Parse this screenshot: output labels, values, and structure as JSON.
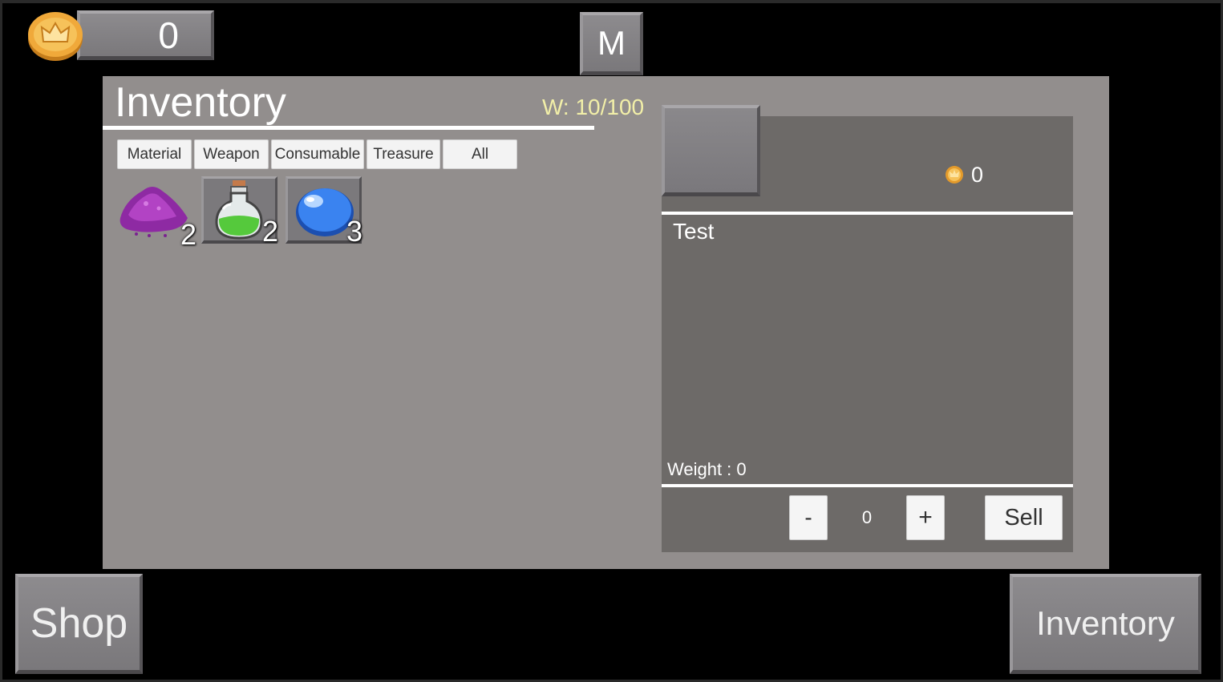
{
  "hud": {
    "coins": "0",
    "menu_button": "M"
  },
  "inventory": {
    "title": "Inventory",
    "weight_capacity": "W: 10/100",
    "tabs": [
      "Material",
      "Weapon",
      "Consumable",
      "Treasure",
      "All"
    ],
    "items": [
      {
        "icon": "purple-dust-icon",
        "quantity": "2"
      },
      {
        "icon": "green-potion-icon",
        "quantity": "2"
      },
      {
        "icon": "blue-slime-icon",
        "quantity": "3"
      }
    ]
  },
  "detail": {
    "price": "0",
    "name": "Test",
    "weight": "Weight : 0",
    "quantity": "0",
    "minus_label": "-",
    "plus_label": "+",
    "sell_label": "Sell"
  },
  "footer": {
    "shop_label": "Shop",
    "inventory_label": "Inventory"
  },
  "colors": {
    "panel": "#928e8d",
    "detail_bg": "#6d6a68",
    "weight_text": "#f2efa8",
    "coin": "#e9a534"
  }
}
